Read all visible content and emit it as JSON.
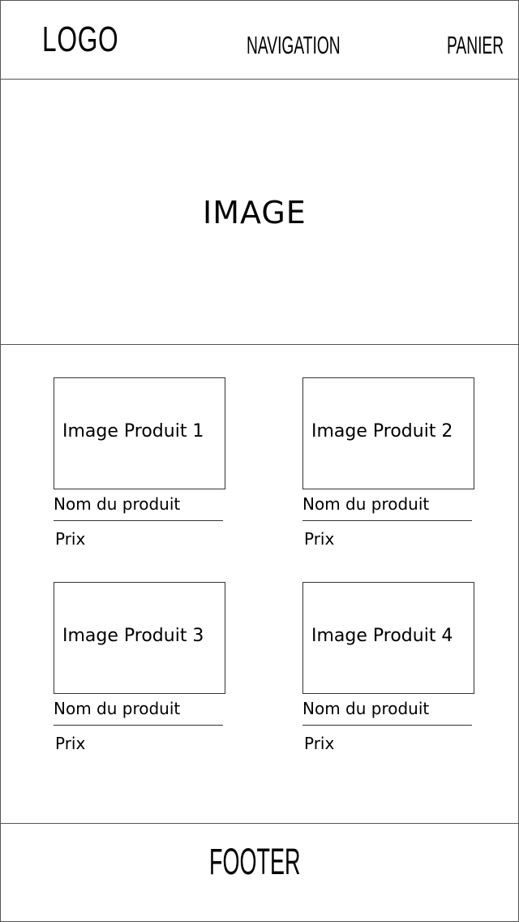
{
  "header": {
    "logo": "LOGO",
    "navigation": "NAVIGATION",
    "cart": "PANIER"
  },
  "hero": {
    "label": "IMAGE"
  },
  "products": [
    {
      "image_label": "Image Produit 1",
      "name": "Nom du produit",
      "price": "Prix"
    },
    {
      "image_label": "Image Produit 2",
      "name": "Nom du produit",
      "price": "Prix"
    },
    {
      "image_label": "Image Produit 3",
      "name": "Nom du produit",
      "price": "Prix"
    },
    {
      "image_label": "Image Produit 4",
      "name": "Nom du produit",
      "price": "Prix"
    }
  ],
  "footer": {
    "label": "FOOTER"
  }
}
